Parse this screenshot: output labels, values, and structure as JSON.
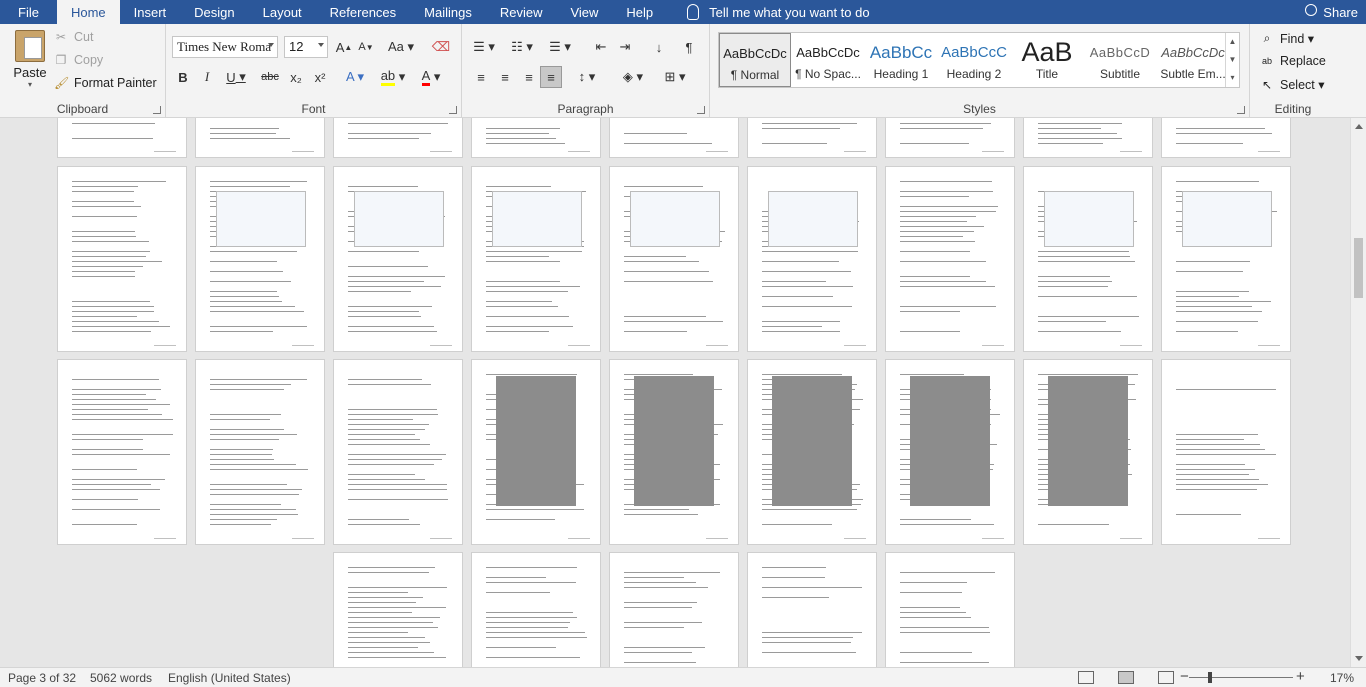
{
  "menubar": {
    "tabs": [
      "File",
      "Home",
      "Insert",
      "Design",
      "Layout",
      "References",
      "Mailings",
      "Review",
      "View",
      "Help"
    ],
    "active_tab": "Home",
    "tell_me": "Tell me what you want to do",
    "share": "Share"
  },
  "clipboard": {
    "paste": "Paste",
    "cut": "Cut",
    "copy": "Copy",
    "format_painter": "Format Painter",
    "label": "Clipboard"
  },
  "font": {
    "name": "Times New Roma",
    "size": "12",
    "label": "Font",
    "buttons": [
      "B",
      "I",
      "U",
      "abc",
      "x₂",
      "x²"
    ]
  },
  "paragraph": {
    "label": "Paragraph"
  },
  "styles": {
    "label": "Styles",
    "items": [
      {
        "sample": "AaBbCcDc",
        "name": "¶ Normal"
      },
      {
        "sample": "AaBbCcDc",
        "name": "¶ No Spac..."
      },
      {
        "sample": "AaBbCc",
        "name": "Heading 1"
      },
      {
        "sample": "AaBbCcC",
        "name": "Heading 2"
      },
      {
        "sample": "AaB",
        "name": "Title"
      },
      {
        "sample": "AaBbCcD",
        "name": "Subtitle"
      },
      {
        "sample": "AaBbCcDc",
        "name": "Subtle Em..."
      }
    ]
  },
  "editing": {
    "label": "Editing",
    "find": "Find",
    "replace": "Replace",
    "select": "Select"
  },
  "status": {
    "page": "Page 3 of 32",
    "words": "5062 words",
    "language": "English (United States)",
    "zoom": "17%",
    "minus": "−",
    "plus": "+"
  },
  "colors": {
    "brand": "#2b579a",
    "highlight": "#ffff00",
    "font_color": "#ff0000"
  }
}
